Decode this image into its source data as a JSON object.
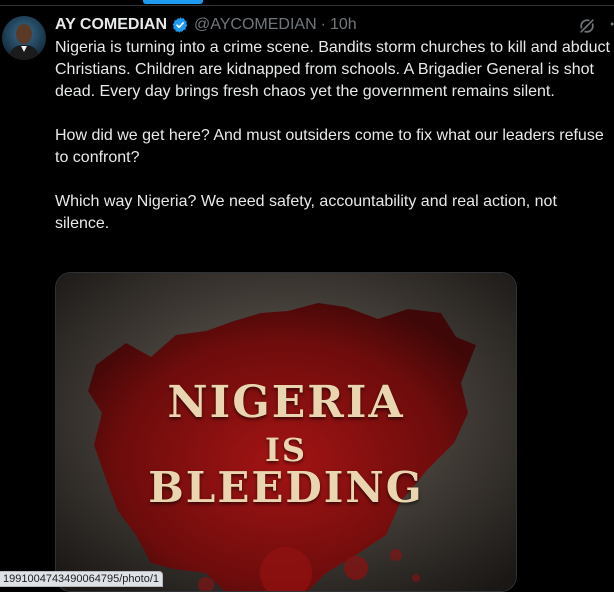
{
  "tweet": {
    "display_name": "AY COMEDIAN",
    "handle": "@AYCOMEDIAN",
    "separator": "·",
    "time": "10h",
    "paragraphs": [
      "Nigeria is turning into a crime scene. Bandits storm churches to kill and abduct Christians. Children are kidnapped from schools. A Brigadier General is shot dead. Every day brings fresh chaos yet the government remains silent.",
      "How did we get here? And must outsiders come to fix what our leaders refuse to confront?",
      "Which way Nigeria? We need safety, accountability and real action, not silence."
    ],
    "media": {
      "line1": "NIGERIA",
      "line2": "IS",
      "line3": "BLEEDING"
    }
  },
  "icons": {
    "verified": "verified-badge-icon",
    "grok": "grok-icon",
    "more": "more-options-icon"
  },
  "colors": {
    "background": "#000000",
    "text": "#e7e9ea",
    "muted": "#71767b",
    "accent": "#1d9bf0",
    "blood": "#8a0d0d"
  },
  "status_bar": {
    "url": "1991004743490064795/photo/1"
  }
}
